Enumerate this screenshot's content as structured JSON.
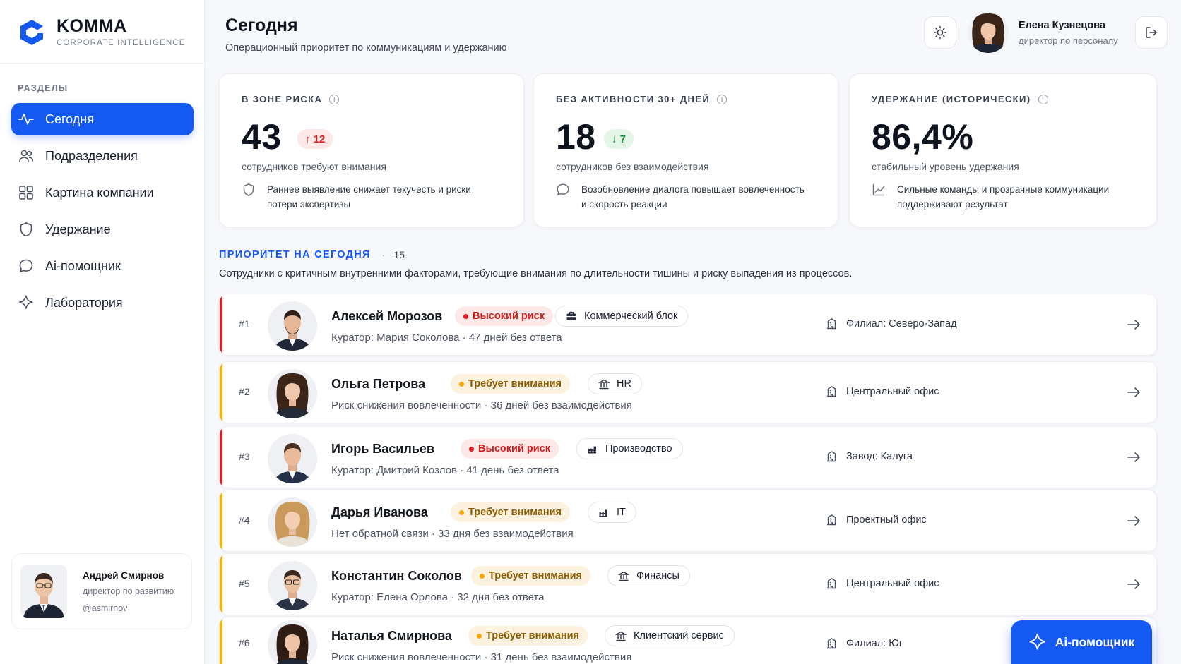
{
  "brand": {
    "name": "KOMMA",
    "subtitle": "CORPORATE INTELLIGENCE",
    "accent": "#1359f2"
  },
  "sidebar": {
    "caption": "РАЗДЕЛЫ",
    "items": [
      {
        "label": "Сегодня",
        "icon": "pulse-icon",
        "active": true
      },
      {
        "label": "Подразделения",
        "icon": "users-icon"
      },
      {
        "label": "Картина компании",
        "icon": "grid-icon"
      },
      {
        "label": "Удержание",
        "icon": "shield-icon"
      },
      {
        "label": "Ai-помощник",
        "icon": "chat-icon"
      },
      {
        "label": "Лаборатория",
        "icon": "sparkle-icon"
      }
    ],
    "user": {
      "name": "Андрей Смирнов",
      "role": "директор по развитию",
      "handle": "@asmirnov"
    }
  },
  "header": {
    "title": "Сегодня",
    "subtitle": "Операционный приоритет по коммуникациям и удержанию",
    "user": {
      "name": "Елена Кузнецова",
      "role": "директор по персоналу"
    }
  },
  "stats": [
    {
      "label": "В ЗОНЕ РИСКА",
      "value": "43",
      "delta": "12",
      "delta_dir": "up",
      "desc": "сотрудников требуют внимания",
      "note": "Раннее выявление снижает текучесть и риски потери экспертизы",
      "note_icon": "shield-icon"
    },
    {
      "label": "БЕЗ АКТИВНОСТИ 30+ ДНЕЙ",
      "value": "18",
      "delta": "7",
      "delta_dir": "down",
      "desc": "сотрудников без взаимодействия",
      "note": "Возобновление диалога повышает вовлеченность и скорость реакции",
      "note_icon": "chat-icon"
    },
    {
      "label": "УДЕРЖАНИЕ (ИСТОРИЧЕСКИ)",
      "value": "86,4%",
      "desc": "стабильный уровень удержания",
      "note": "Сильные команды и прозрачные коммуникации поддерживают результат",
      "note_icon": "trend-icon"
    }
  ],
  "priority": {
    "title": "ПРИОРИТЕТ НА СЕГОДНЯ",
    "count": "15",
    "desc": "Сотрудники с критичным внутренними факторами, требующие внимания по длительности тишины и риску выпадения из процессов.",
    "rows": [
      {
        "rank": "#1",
        "name": "Алексей Морозов",
        "status": "Высокий риск",
        "level": "high",
        "dept": "Коммерческий блок",
        "sub": "Куратор: Мария Соколова  · 47 дней без ответа",
        "location": "Филиал: Северо-Запад"
      },
      {
        "rank": "#2",
        "name": "Ольга Петрова",
        "status": "Требует внимания",
        "level": "attn",
        "dept": "HR",
        "sub": "Риск снижения вовлеченности  · 36 дней без взаимодействия",
        "location": "Центральный офис"
      },
      {
        "rank": "#3",
        "name": "Игорь Васильев",
        "status": "Высокий риск",
        "level": "high",
        "dept": "Производство",
        "sub": "Куратор: Дмитрий Козлов  · 41 день без ответа",
        "location": "Завод: Калуга"
      },
      {
        "rank": "#4",
        "name": "Дарья Иванова",
        "status": "Требует внимания",
        "level": "attn",
        "dept": "IT",
        "sub": "Нет обратной связи  · 33 дня без взаимодействия",
        "location": "Проектный офис"
      },
      {
        "rank": "#5",
        "name": "Константин Соколов",
        "status": "Требует внимания",
        "level": "attn",
        "dept": "Финансы",
        "sub": "Куратор: Елена Орлова  · 32 дня без ответа",
        "location": "Центральный офис"
      },
      {
        "rank": "#6",
        "name": "Наталья Смирнова",
        "status": "Требует внимания",
        "level": "attn",
        "dept": "Клиентский сервис",
        "sub": "Риск снижения вовлеченности  · 31 день без взаимодействия",
        "location": "Филиал: Юг"
      }
    ]
  },
  "fab": {
    "label": "Ai-помощник"
  },
  "colors": {
    "high": "#e01c1c",
    "attention": "#f5b300",
    "primary": "#1359f2"
  }
}
